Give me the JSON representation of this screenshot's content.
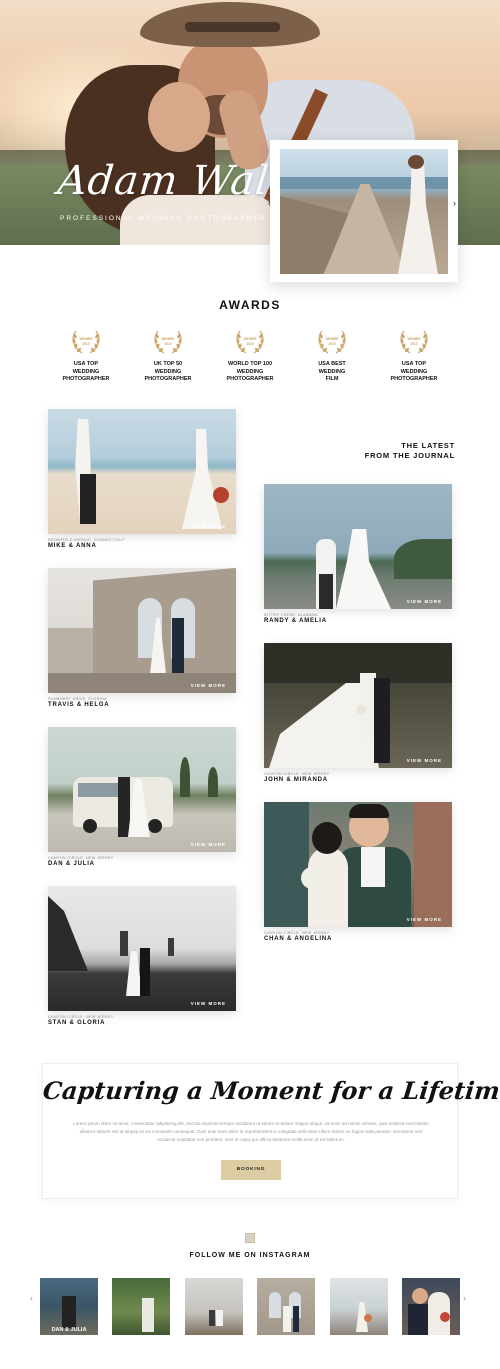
{
  "hero": {
    "title": "Adam Walker",
    "subtitle": "PROFESSIONAL WEDDING PHOTOGRAPHER",
    "prev_arrow": "‹",
    "next_arrow": "›"
  },
  "awards": {
    "title": "AWARDS",
    "badge_text": "WINNER 2019",
    "items": [
      {
        "line1": "USA TOP",
        "line2": "WEDDING",
        "line3": "PHOTOGRAPHER"
      },
      {
        "line1": "UK TOP 50",
        "line2": "WEDDING",
        "line3": "PHOTOGRAPHER"
      },
      {
        "line1": "WORLD TOP 100",
        "line2": "WEDDING",
        "line3": "PHOTOGRAPHER"
      },
      {
        "line1": "USA BEST",
        "line2": "WEDDING",
        "line3": "FILM"
      },
      {
        "line1": "USA TOP",
        "line2": "WEDDING",
        "line3": "PHOTOGRAPHER"
      }
    ]
  },
  "journal": {
    "heading_line1": "THE LATEST",
    "heading_line2": "FROM THE JOURNAL",
    "view_more": "VIEW MORE",
    "posts": [
      {
        "location": "BROMFIELD AVENUE, CONNECTICUT",
        "names": "MIKE & ANNA"
      },
      {
        "location": "BITTER CREEK, ALABAMA",
        "names": "RANDY & AMELIA"
      },
      {
        "location": "SUNBURST DRIVE, FLORIDA",
        "names": "TRAVIS & HELGA"
      },
      {
        "location": "CANYON CIRCLE, NEW JERSEY",
        "names": "JOHN & MIRANDA"
      },
      {
        "location": "CANYON CIRCLE, NEW JERSEY",
        "names": "DAN & JULIA"
      },
      {
        "location": "CANYON CIRCLE, NEW JERSEY",
        "names": "CHAN & ANGELINA"
      },
      {
        "location": "CANYON CIRCLE, NEW JERSEY",
        "names": "STAN & GLORIA"
      }
    ]
  },
  "cta": {
    "title": "Capturing a Moment for a Lifetime",
    "body": "Lorem ipsum dolor sit amet, consectetur adipiscing elit, sed do eiusmod tempor incididunt ut labore et dolore magna aliqua. Ut enim ad minim veniam, quis nostrud exercitation ullamco laboris nisi ut aliquip ex ea commodo consequat. Duis aute irure dolor in reprehenderit in voluptate velit esse cillum dolore eu fugiat nulla pariatur. Excepteur sint occaecat cupidatat non proident, sunt in culpa qui officia deserunt mollit anim id est laborum.",
    "button": "BOOKING"
  },
  "instagram": {
    "title": "FOLLOW ME ON INSTAGRAM",
    "first_caption": "DAN & JULIA",
    "prev_arrow": "‹",
    "next_arrow": "›"
  },
  "colors": {
    "accent": "#dccca4",
    "laurel": "#c9a86a",
    "text": "#111111",
    "muted": "#8a8a8a"
  }
}
